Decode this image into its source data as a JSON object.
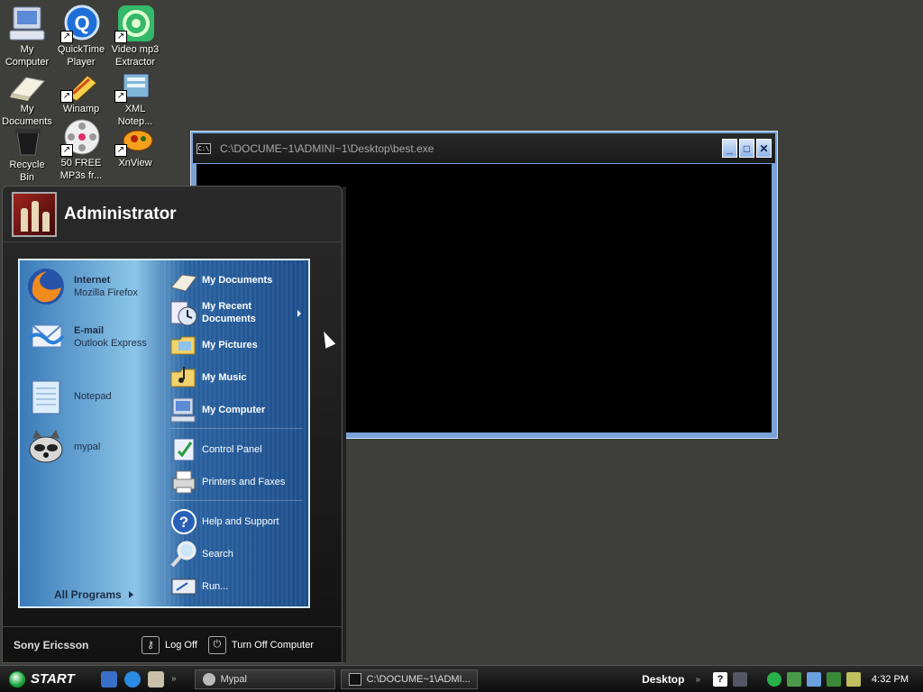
{
  "desktop": {
    "icons": [
      {
        "label": "My\nComputer",
        "icon": "computer-icon"
      },
      {
        "label": "QuickTime\nPlayer",
        "icon": "quicktime-icon"
      },
      {
        "label": "Video mp3\nExtractor",
        "icon": "video-extractor-icon"
      },
      {
        "label": "My\nDocuments",
        "icon": "documents-icon"
      },
      {
        "label": "Winamp",
        "icon": "winamp-icon"
      },
      {
        "label": "XML\nNotep...",
        "icon": "xml-notepad-icon"
      },
      {
        "label": "Recycle\nBin",
        "icon": "recycle-bin-icon"
      },
      {
        "label": "50 FREE\nMP3s fr...",
        "icon": "film-reel-icon"
      },
      {
        "label": "XnView",
        "icon": "xnview-icon"
      }
    ]
  },
  "console_window": {
    "title": "C:\\DOCUME~1\\ADMINI~1\\Desktop\\best.exe",
    "icon_text": "C:\\"
  },
  "start_menu": {
    "user_name": "Administrator",
    "pinned": [
      {
        "title": "Internet",
        "subtitle": "Mozilla Firefox",
        "icon": "firefox-icon"
      },
      {
        "title": "E-mail",
        "subtitle": "Outlook Express",
        "icon": "outlook-express-icon"
      },
      {
        "title": "Notepad",
        "icon": "notepad-icon"
      },
      {
        "title": "mypal",
        "icon": "raccoon-icon"
      }
    ],
    "all_programs": "All Programs",
    "places": [
      {
        "label": "My Documents",
        "icon": "documents-icon"
      },
      {
        "label": "My Recent Documents",
        "icon": "recent-documents-icon"
      },
      {
        "label": "My Pictures",
        "icon": "pictures-folder-icon"
      },
      {
        "label": "My Music",
        "icon": "music-folder-icon"
      },
      {
        "label": "My Computer",
        "icon": "computer-icon"
      },
      {
        "label": "Control Panel",
        "icon": "control-panel-icon"
      },
      {
        "label": "Printers and Faxes",
        "icon": "printer-icon"
      },
      {
        "label": "Help and Support",
        "icon": "help-icon"
      },
      {
        "label": "Search",
        "icon": "search-icon"
      },
      {
        "label": "Run...",
        "icon": "run-icon"
      }
    ],
    "footer": {
      "brand": "Sony Ericsson",
      "log_off": "Log Off",
      "turn_off": "Turn Off Computer"
    }
  },
  "taskbar": {
    "start_label": "START",
    "tasks": [
      {
        "label": "Mypal",
        "icon": "raccoon-icon"
      },
      {
        "label": "C:\\DOCUME~1\\ADMI...",
        "icon": "console-icon"
      }
    ],
    "desktop_toolbar": "Desktop",
    "clock": "4:32 PM"
  }
}
